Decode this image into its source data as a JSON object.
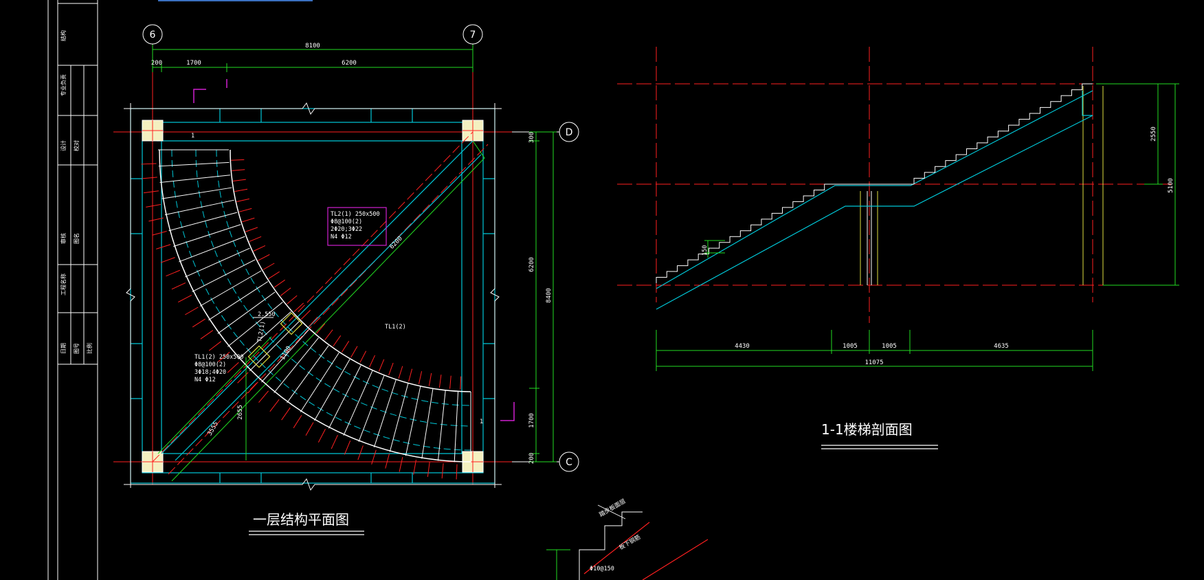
{
  "plan": {
    "title": "一层结构平面图",
    "axes": {
      "left": "6",
      "right": "7",
      "top": "D",
      "bottom": "C"
    },
    "dims_top": {
      "total": "8100",
      "left": "200",
      "mid": "1700",
      "right": "6200"
    },
    "dims_right": {
      "top": "300",
      "mid": "6200",
      "lower": "1700",
      "bottom": "200",
      "total": "8400"
    },
    "diag_dims": {
      "main": "6200",
      "lower_left": "3555",
      "vertical": "2655",
      "small": "1100"
    },
    "beam_note_tl2": [
      "TL2(1) 250x500",
      "Φ8@100(2)",
      "2Φ20;3Φ22",
      "N4 Φ12"
    ],
    "beam_note_tl1": [
      "TL1(2) 250x500",
      "Φ8@100(2)",
      "3Φ18;4Φ20",
      "N4 Φ12"
    ],
    "labels": {
      "tl1_2": "TL1(2)",
      "tl2_1": "TL2(1)",
      "elev": "2.550",
      "section_mark": "1"
    }
  },
  "section": {
    "title": "1-1楼梯剖面图",
    "dims_bottom": [
      "4430",
      "1005",
      "1005",
      "4635"
    ],
    "total": "11075",
    "dims_right": {
      "upper": "2550",
      "total": "5100"
    },
    "step_height": "150"
  },
  "detail": {
    "labels": [
      "踏步板面层",
      "Φ10@150",
      "板下钢筋"
    ]
  },
  "title_block": {
    "rows": [
      "结构",
      "专业负责",
      "设计",
      "校对",
      "审核",
      "图名",
      "工程名称",
      "日期",
      "图号",
      "比例"
    ]
  },
  "colors": {
    "cyan": "#00c8d8",
    "red": "#ff2020",
    "green": "#22dd22",
    "white": "#ffffff",
    "magenta": "#d020d0",
    "yellow": "#e0e040"
  }
}
